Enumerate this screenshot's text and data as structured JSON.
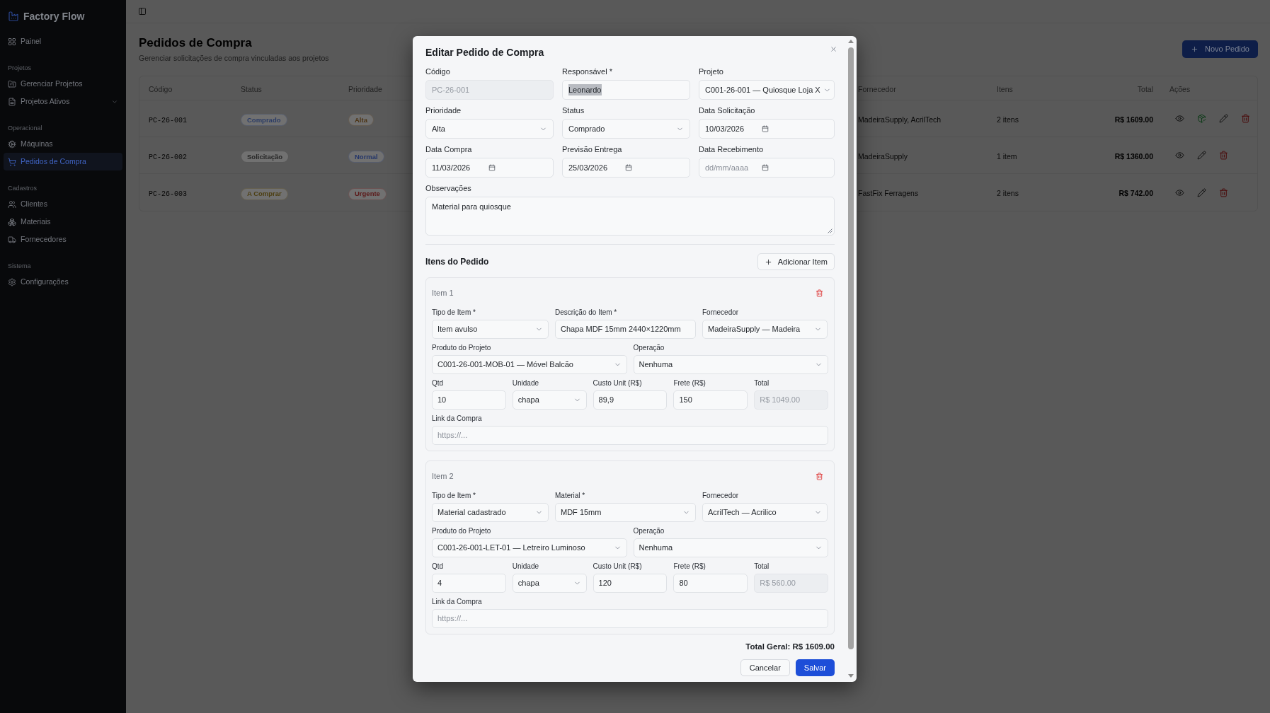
{
  "sidebar": {
    "brand": "Factory Flow",
    "groups": [
      {
        "items": [
          {
            "label": "Painel",
            "selected": false
          }
        ]
      },
      {
        "title": "Projetos",
        "items": [
          {
            "label": "Gerenciar Projetos",
            "selected": false
          },
          {
            "label": "Projetos Ativos",
            "selected": false,
            "expanded": false
          }
        ]
      },
      {
        "title": "Operacional",
        "items": [
          {
            "label": "Máquinas",
            "selected": false
          },
          {
            "label": "Pedidos de Compra",
            "selected": true
          }
        ]
      },
      {
        "title": "Cadastros",
        "items": [
          {
            "label": "Clientes",
            "selected": false
          },
          {
            "label": "Materiais",
            "selected": false
          },
          {
            "label": "Fornecedores",
            "selected": false
          }
        ]
      },
      {
        "title": "Sistema",
        "items": [
          {
            "label": "Configurações",
            "selected": false
          }
        ]
      }
    ]
  },
  "page": {
    "title": "Pedidos de Compra",
    "subtitle": "Gerenciar solicitações de compra vinculadas aos projetos",
    "new_button": "Novo Pedido"
  },
  "table": {
    "columns": [
      "Código",
      "Status",
      "Prioridade",
      "Fornecedor",
      "Itens",
      "Total",
      "Ações"
    ],
    "rows": [
      {
        "code": "PC-26-001",
        "status": {
          "label": "Comprado",
          "color": "#2b3c66"
        },
        "priority": {
          "label": "Alta",
          "color": "#4d3414"
        },
        "supplier": "MadeiraSupply, AcrilTech",
        "items": "2 itens",
        "total": "R$ 1609.00",
        "actions": [
          {
            "kind": "view"
          },
          {
            "kind": "receive"
          },
          {
            "kind": "edit"
          },
          {
            "kind": "delete"
          }
        ]
      },
      {
        "code": "PC-26-002",
        "status": {
          "label": "Solicitação",
          "color": "#262626"
        },
        "priority": {
          "label": "Normal",
          "color": "#24366a"
        },
        "supplier": "MadeiraSupply",
        "items": "1 item",
        "total": "R$ 1360.00",
        "actions": [
          {
            "kind": "view"
          },
          {
            "kind": "edit"
          },
          {
            "kind": "delete"
          }
        ]
      },
      {
        "code": "PC-26-003",
        "status": {
          "label": "A Comprar",
          "color": "#4d3f12"
        },
        "priority": {
          "label": "Urgente",
          "color": "#5c1a1a"
        },
        "supplier": "FastFix Ferragens",
        "items": "2 itens",
        "total": "R$ 742.00",
        "actions": [
          {
            "kind": "view"
          },
          {
            "kind": "edit"
          },
          {
            "kind": "delete"
          }
        ]
      }
    ]
  },
  "dialog": {
    "title": "Editar Pedido de Compra",
    "fields": [
      {
        "label": "Código",
        "kind": "readonly",
        "value": "PC-26-001",
        "highlighted": false
      },
      {
        "label": "Responsável *",
        "kind": "text",
        "value": "Leonardo",
        "highlighted": true
      },
      {
        "label": "Projeto",
        "kind": "select",
        "value": "C001-26-001 — Quiosque Loja X",
        "highlighted": false
      },
      {
        "label": "Prioridade",
        "kind": "select",
        "value": "Alta",
        "highlighted": false
      },
      {
        "label": "Status",
        "kind": "select",
        "value": "Comprado",
        "highlighted": false
      },
      {
        "label": "Data Solicitação",
        "kind": "date",
        "value": "10/03/2026",
        "highlighted": false
      },
      {
        "label": "Data Compra",
        "kind": "date",
        "value": "11/03/2026",
        "highlighted": false
      },
      {
        "label": "Previsão Entrega",
        "kind": "date",
        "value": "25/03/2026",
        "highlighted": false
      },
      {
        "label": "Data Recebimento",
        "kind": "date",
        "placeholder": "dd/mm/aaaa",
        "highlighted": false
      }
    ],
    "notes": {
      "label": "Observações",
      "value": "Material para quiosque"
    },
    "items_title": "Itens do Pedido",
    "add_item_button": "Adicionar Item",
    "items": [
      {
        "title": "Item 1",
        "main_fields": [
          {
            "label": "Tipo de Item *",
            "kind": "select",
            "value": "Item avulso"
          },
          {
            "label": "Descrição do Item *",
            "kind": "text",
            "value": "Chapa MDF 15mm 2440×1220mm"
          },
          {
            "label": "Fornecedor",
            "kind": "select",
            "value": "MadeiraSupply — Madeira"
          }
        ],
        "project_fields": [
          {
            "label": "Produto do Projeto",
            "kind": "select",
            "value": "C001-26-001-MOB-01 — Móvel Balcão"
          },
          {
            "label": "Operação",
            "kind": "select",
            "value": "Nenhuma"
          }
        ],
        "cost_fields": [
          {
            "label": "Qtd",
            "kind": "text",
            "value": "10"
          },
          {
            "label": "Unidade",
            "kind": "select",
            "value": "chapa"
          },
          {
            "label": "Custo Unit (R$)",
            "kind": "text",
            "value": "89,9"
          },
          {
            "label": "Frete (R$)",
            "kind": "text",
            "value": "150"
          },
          {
            "label": "Total",
            "kind": "readonly",
            "value": "R$ 1049.00"
          }
        ],
        "link_field": {
          "label": "Link da Compra",
          "kind": "text",
          "placeholder": "https://..."
        }
      },
      {
        "title": "Item 2",
        "main_fields": [
          {
            "label": "Tipo de Item *",
            "kind": "select",
            "value": "Material cadastrado"
          },
          {
            "label": "Material *",
            "kind": "select",
            "value": "MDF 15mm"
          },
          {
            "label": "Fornecedor",
            "kind": "select",
            "value": "AcrilTech — Acrilico"
          }
        ],
        "project_fields": [
          {
            "label": "Produto do Projeto",
            "kind": "select",
            "value": "C001-26-001-LET-01 — Letreiro Luminoso"
          },
          {
            "label": "Operação",
            "kind": "select",
            "value": "Nenhuma"
          }
        ],
        "cost_fields": [
          {
            "label": "Qtd",
            "kind": "text",
            "value": "4"
          },
          {
            "label": "Unidade",
            "kind": "select",
            "value": "chapa"
          },
          {
            "label": "Custo Unit (R$)",
            "kind": "text",
            "value": "120"
          },
          {
            "label": "Frete (R$)",
            "kind": "text",
            "value": "80"
          },
          {
            "label": "Total",
            "kind": "readonly",
            "value": "R$ 560.00"
          }
        ],
        "link_field": {
          "label": "Link da Compra",
          "kind": "text",
          "placeholder": "https://..."
        }
      }
    ],
    "grand_total": "Total Geral: R$ 1609.00",
    "buttons": [
      {
        "label": "Cancelar",
        "kind": "secondary"
      },
      {
        "label": "Salvar",
        "kind": "primary"
      }
    ]
  }
}
